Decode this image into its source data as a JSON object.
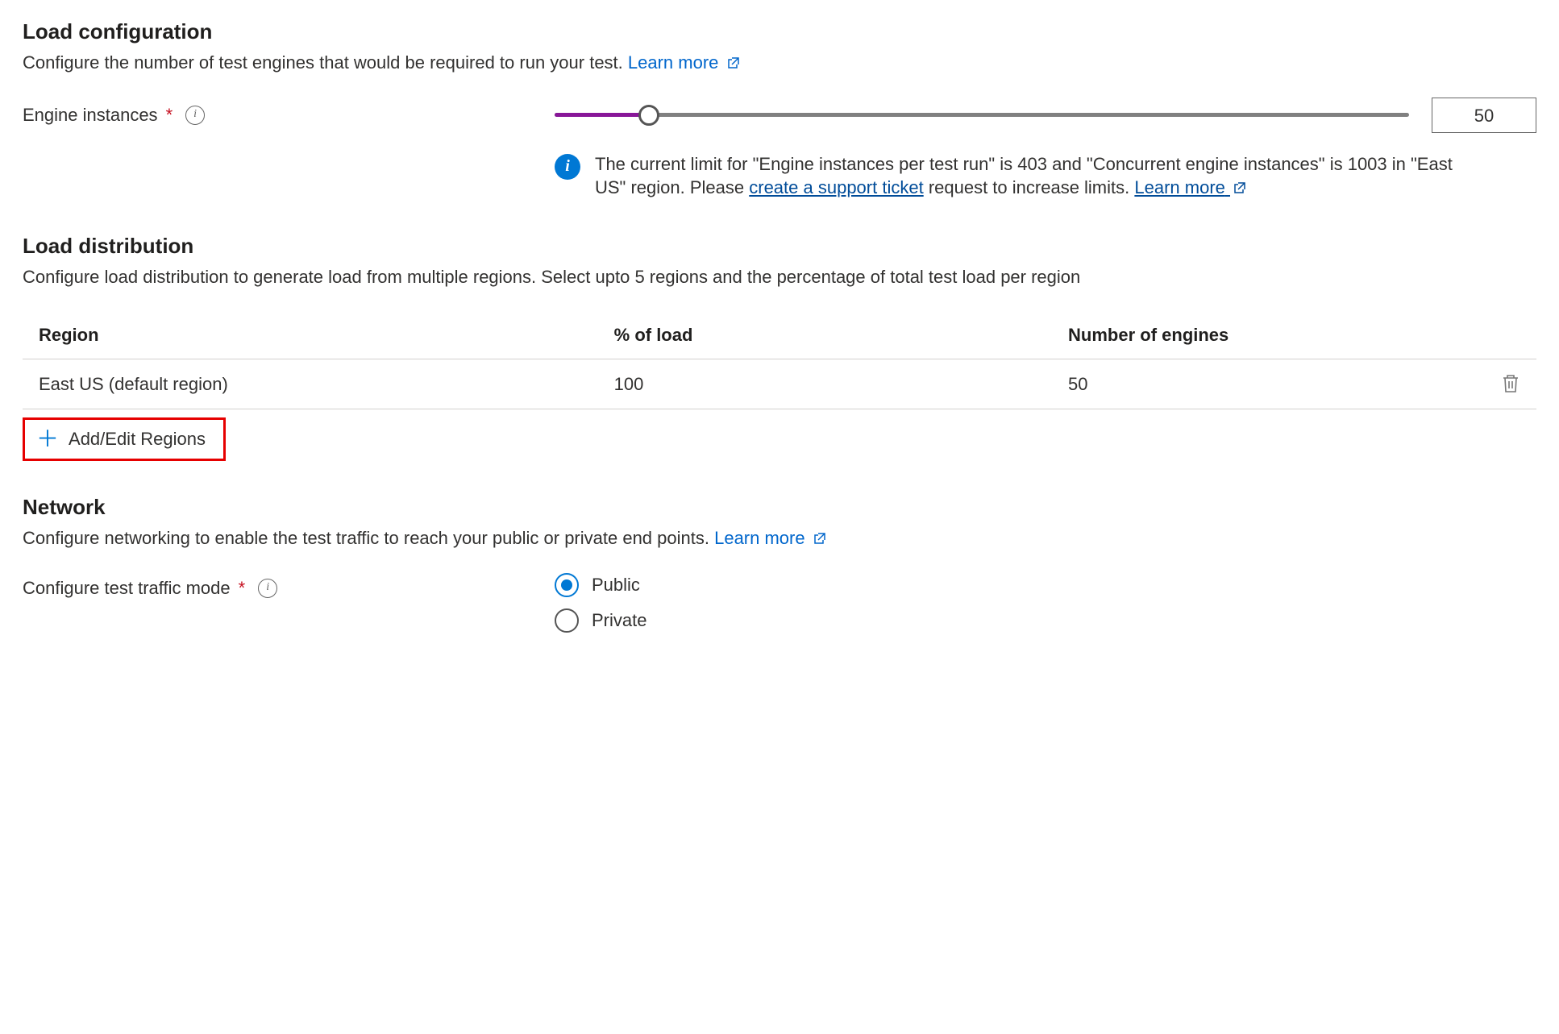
{
  "loadConfig": {
    "title": "Load configuration",
    "desc": "Configure the number of test engines that would be required to run your test. ",
    "learnMoreLabel": "Learn more",
    "engineInstancesLabel": "Engine instances",
    "engineInstancesValue": "50",
    "sliderPercent": 11,
    "limitMsgPart1": "The current limit for \"Engine instances per test run\" is 403 and \"Concurrent engine instances\" is 1003 in \"East US\" region. Please ",
    "limitMsgLink1": "create a support ticket",
    "limitMsgPart2": " request to increase limits. ",
    "limitMsgLink2": "Learn more"
  },
  "loadDist": {
    "title": "Load distribution",
    "desc": "Configure load distribution to generate load from multiple regions. Select upto 5 regions and the percentage of total test load per region",
    "columns": {
      "region": "Region",
      "load": "% of load",
      "engines": "Number of engines"
    },
    "rows": [
      {
        "region": "East US (default region)",
        "load": "100",
        "engines": "50"
      }
    ],
    "addEditLabel": "Add/Edit Regions"
  },
  "network": {
    "title": "Network",
    "desc": "Configure networking to enable the test traffic to reach your public or private end points. ",
    "learnMoreLabel": "Learn more",
    "trafficModeLabel": "Configure test traffic mode",
    "options": {
      "public": "Public",
      "private": "Private"
    },
    "selected": "public"
  }
}
